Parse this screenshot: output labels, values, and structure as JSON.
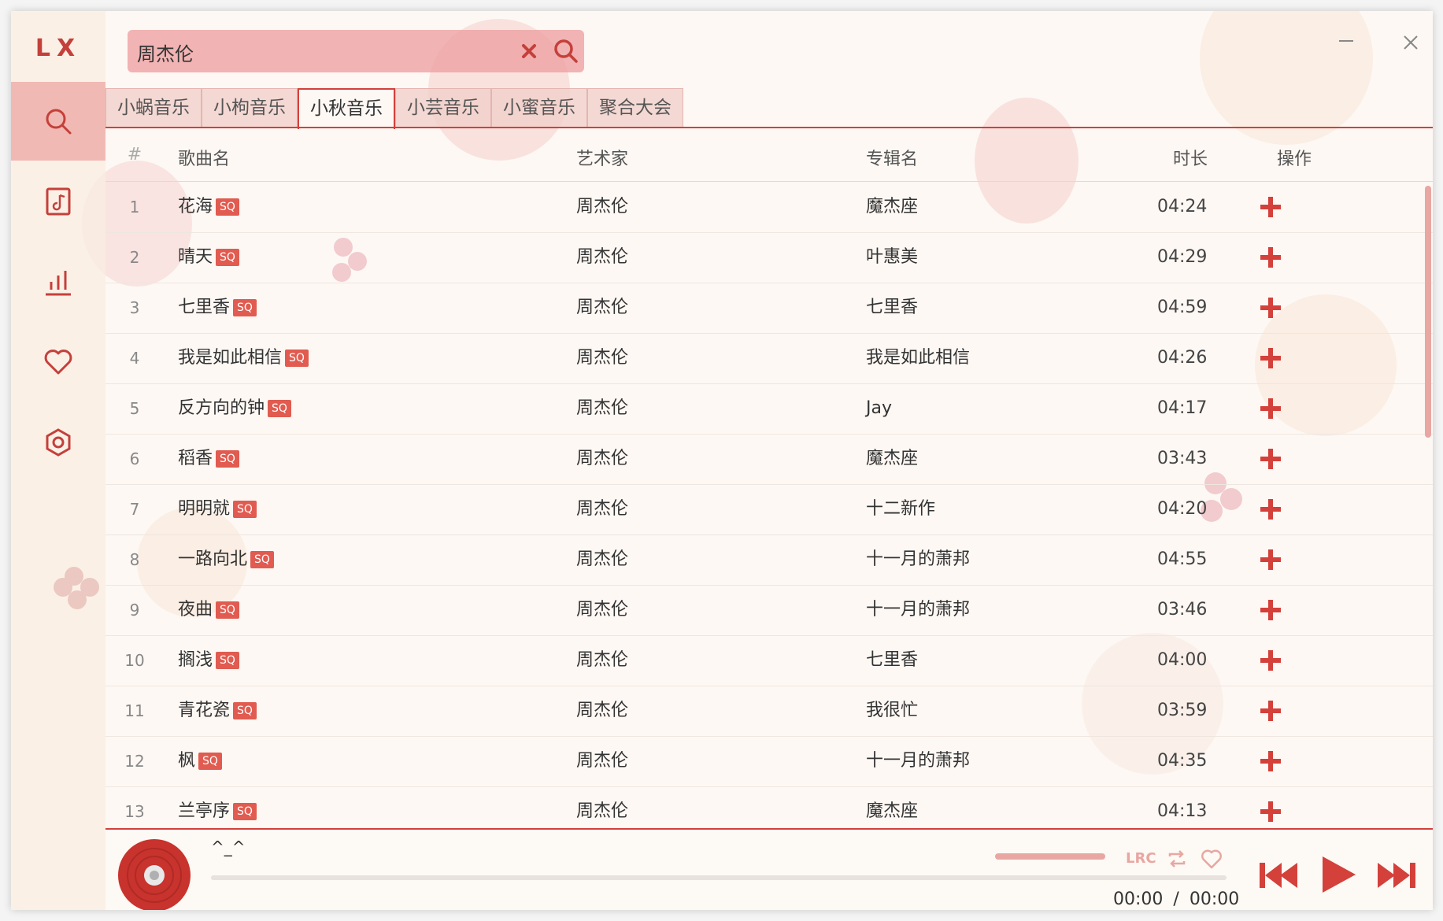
{
  "app": {
    "logo": "LX"
  },
  "sidebar": {
    "items": [
      {
        "icon": "search-icon",
        "active": true
      },
      {
        "icon": "music-library-icon"
      },
      {
        "icon": "chart-icon"
      },
      {
        "icon": "heart-icon"
      },
      {
        "icon": "settings-icon"
      }
    ]
  },
  "search": {
    "value": "周杰伦",
    "placeholder": ""
  },
  "tabs": [
    {
      "label": "小蜗音乐"
    },
    {
      "label": "小枸音乐"
    },
    {
      "label": "小秋音乐",
      "active": true
    },
    {
      "label": "小芸音乐"
    },
    {
      "label": "小蜜音乐"
    },
    {
      "label": "聚合大会"
    }
  ],
  "table": {
    "headers": {
      "index": "#",
      "name": "歌曲名",
      "artist": "艺术家",
      "album": "专辑名",
      "duration": "时长",
      "action": "操作"
    },
    "rows": [
      {
        "index": "1",
        "name": "花海",
        "quality": "SQ",
        "artist": "周杰伦",
        "album": "魔杰座",
        "duration": "04:24"
      },
      {
        "index": "2",
        "name": "晴天",
        "quality": "SQ",
        "artist": "周杰伦",
        "album": "叶惠美",
        "duration": "04:29"
      },
      {
        "index": "3",
        "name": "七里香",
        "quality": "SQ",
        "artist": "周杰伦",
        "album": "七里香",
        "duration": "04:59"
      },
      {
        "index": "4",
        "name": "我是如此相信",
        "quality": "SQ",
        "artist": "周杰伦",
        "album": "我是如此相信",
        "duration": "04:26"
      },
      {
        "index": "5",
        "name": "反方向的钟",
        "quality": "SQ",
        "artist": "周杰伦",
        "album": "Jay",
        "duration": "04:17"
      },
      {
        "index": "6",
        "name": "稻香",
        "quality": "SQ",
        "artist": "周杰伦",
        "album": "魔杰座",
        "duration": "03:43"
      },
      {
        "index": "7",
        "name": "明明就",
        "quality": "SQ",
        "artist": "周杰伦",
        "album": "十二新作",
        "duration": "04:20"
      },
      {
        "index": "8",
        "name": "一路向北",
        "quality": "SQ",
        "artist": "周杰伦",
        "album": "十一月的萧邦",
        "duration": "04:55"
      },
      {
        "index": "9",
        "name": "夜曲",
        "quality": "SQ",
        "artist": "周杰伦",
        "album": "十一月的萧邦",
        "duration": "03:46"
      },
      {
        "index": "10",
        "name": "搁浅",
        "quality": "SQ",
        "artist": "周杰伦",
        "album": "七里香",
        "duration": "04:00"
      },
      {
        "index": "11",
        "name": "青花瓷",
        "quality": "SQ",
        "artist": "周杰伦",
        "album": "我很忙",
        "duration": "03:59"
      },
      {
        "index": "12",
        "name": "枫",
        "quality": "SQ",
        "artist": "周杰伦",
        "album": "十一月的萧邦",
        "duration": "04:35"
      },
      {
        "index": "13",
        "name": "兰亭序",
        "quality": "SQ",
        "artist": "周杰伦",
        "album": "魔杰座",
        "duration": "04:13"
      }
    ]
  },
  "player": {
    "title": "^_^",
    "current_time": "00:00",
    "separator": "/",
    "total_time": "00:00",
    "lyrics_label": "LRC"
  },
  "colors": {
    "accent": "#d4403a",
    "accent_light": "#e8a7a2",
    "background": "#fdf8f4"
  }
}
